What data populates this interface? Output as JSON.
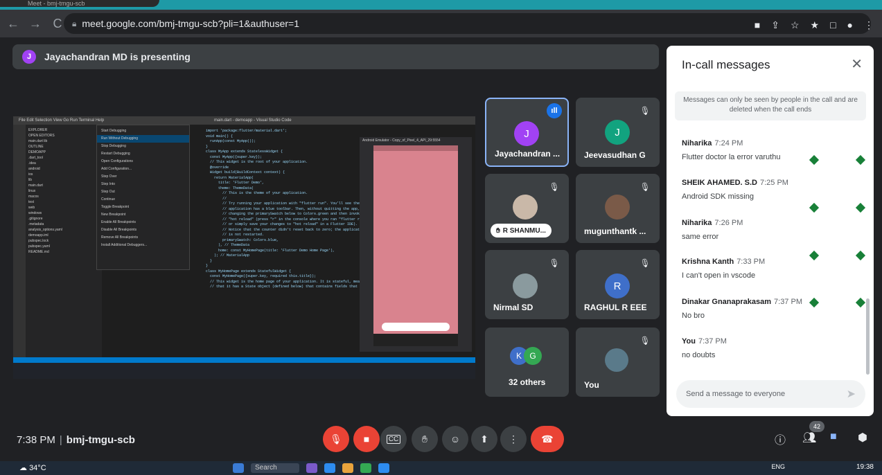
{
  "browser": {
    "tab_title": "Meet - bmj-tmgu-scb",
    "url": "meet.google.com/bmj-tmgu-scb?pli=1&authuser=1"
  },
  "presenting": {
    "initial": "J",
    "text": "Jayachandran MD is presenting"
  },
  "shared_screen": {
    "window_title": "main.dart - demoapp - Visual Studio Code",
    "menu_items": [
      "Start Debugging",
      "Run Without Debugging",
      "Stop Debugging",
      "Restart Debugging",
      "Open Configurations",
      "Add Configuration...",
      "Step Over",
      "Step Into",
      "Step Out",
      "Continue",
      "Toggle Breakpoint",
      "New Breakpoint",
      "Enable All Breakpoints",
      "Disable All Breakpoints",
      "Remove All Breakpoints",
      "Install Additional Debuggers..."
    ],
    "sidebar_items": [
      "EXPLORER",
      "OPEN EDITORS",
      "main.dart lib",
      "OUTLINE",
      "DEMOAPP",
      ".dart_tool",
      ".idea",
      "android",
      "ios",
      "lib",
      "main.dart",
      "linux",
      "macos",
      "test",
      "web",
      "windows",
      ".gitignore",
      ".metadata",
      "analysis_options.yaml",
      "demoapp.iml",
      "pubspec.lock",
      "pubspec.yaml",
      "README.md"
    ],
    "code_lines": [
      "import 'package:flutter/material.dart';",
      "",
      "void main() {",
      "  runApp(const MyApp());",
      "}",
      "",
      "class MyApp extends StatelessWidget {",
      "  const MyApp({super.key});",
      "",
      "  // This widget is the root of your application.",
      "  @override",
      "  Widget build(BuildContext context) {",
      "    return MaterialApp(",
      "      title: 'Flutter Demo',",
      "      theme: ThemeData(",
      "        // This is the theme of your application.",
      "        //",
      "        // Try running your application with \"flutter run\". You'll see the",
      "        // application has a blue toolbar. Then, without quitting the app, try",
      "        // changing the primarySwatch below to Colors.green and then invoke",
      "        // \"hot reload\" (press \"r\" in the console where you ran \"flutter run\",",
      "        // or simply save your changes to \"hot reload\" in a Flutter IDE).",
      "        // Notice that the counter didn't reset back to zero; the application",
      "        // is not restarted.",
      "        primarySwatch: Colors.blue,",
      "      ), // ThemeData",
      "      home: const MyHomePage(title: 'Flutter Demo Home Page'),",
      "    ); // MaterialApp",
      "  }",
      "}",
      "",
      "class MyHomePage extends StatefulWidget {",
      "  const MyHomePage({super.key, required this.title});",
      "",
      "  // This widget is the home page of your application. It is stateful, meaning",
      "  // that it has a State object (defined below) that contains fields that affect"
    ],
    "emulator_title": "Android Emulator - Copy_of_Pixel_4_API_29:5554"
  },
  "tiles": [
    {
      "label": "Jayachandran ...",
      "initial": "J",
      "color": "#a142f4"
    },
    {
      "label": "Jeevasudhan G",
      "initial": "J",
      "color": "#12a37f"
    },
    {
      "label": "R SHANMU...",
      "initial": "",
      "color": ""
    },
    {
      "label": "mugunthantk ...",
      "initial": "",
      "color": ""
    },
    {
      "label": "Nirmal SD",
      "initial": "",
      "color": ""
    },
    {
      "label": "RAGHUL R EEE",
      "initial": "R",
      "color": "#3f6fc9"
    },
    {
      "label": "32 others",
      "initial_a": "K",
      "initial_b": "G",
      "color_a": "#3f6fc9",
      "color_b": "#34a853"
    },
    {
      "label": "You",
      "initial": "",
      "color": ""
    }
  ],
  "chat": {
    "title": "In-call messages",
    "notice": "Messages can only be seen by people in the call and are deleted when the call ends",
    "messages": [
      {
        "sender": "Niharika",
        "time": "7:24 PM",
        "text": "Flutter doctor la error varuthu"
      },
      {
        "sender": "SHEIK AHAMED. S.D",
        "time": "7:25 PM",
        "text": "Android SDK missing"
      },
      {
        "sender": "Niharika",
        "time": "7:26 PM",
        "text": "same error"
      },
      {
        "sender": "Krishna Kanth",
        "time": "7:33 PM",
        "text": "I can't open in vscode"
      },
      {
        "sender": "Dinakar Gnanaprakasam",
        "time": "7:37 PM",
        "text": "No bro"
      },
      {
        "sender": "You",
        "time": "7:37 PM",
        "text": "no doubts"
      }
    ],
    "input_placeholder": "Send a message to everyone"
  },
  "bottom": {
    "time": "7:38 PM",
    "separator": "|",
    "meeting_code": "bmj-tmgu-scb",
    "people_count": "42",
    "cc_label": "CC"
  },
  "taskbar": {
    "temperature": "34°C",
    "search": "Search",
    "lang": "ENG",
    "clock": "19:38"
  },
  "colors": {
    "accent_red": "#ea4335",
    "accent_blue": "#8ab4f8",
    "chat_green": "#188038"
  }
}
